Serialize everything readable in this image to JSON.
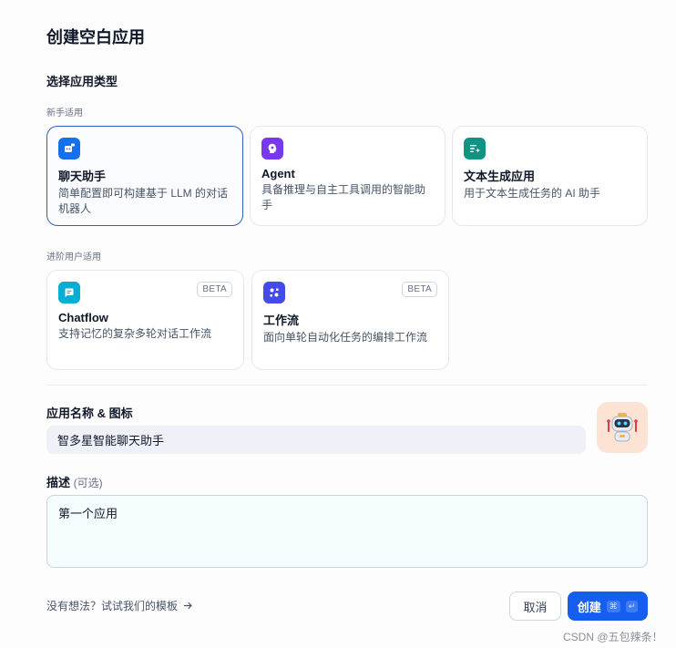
{
  "dialog": {
    "title": "创建空白应用"
  },
  "app_type": {
    "section_title": "选择应用类型",
    "beginner_label": "新手适用",
    "advanced_label": "进阶用户适用",
    "beginner_cards": [
      {
        "title": "聊天助手",
        "desc": "简单配置即可构建基于 LLM 的对话机器人",
        "icon": "chat-bot-icon",
        "color": "#1570ef",
        "selected": true
      },
      {
        "title": "Agent",
        "desc": "具备推理与自主工具调用的智能助手",
        "icon": "agent-icon",
        "color": "#7839ee",
        "selected": false
      },
      {
        "title": "文本生成应用",
        "desc": "用于文本生成任务的 AI 助手",
        "icon": "text-generation-icon",
        "color": "#0e9384",
        "selected": false
      }
    ],
    "advanced_cards": [
      {
        "title": "Chatflow",
        "desc": "支持记忆的复杂多轮对话工作流",
        "icon": "chatflow-icon",
        "color": "#06aed4",
        "badge": "BETA"
      },
      {
        "title": "工作流",
        "desc": "面向单轮自动化任务的编排工作流",
        "icon": "workflow-icon",
        "color": "#444ce7",
        "badge": "BETA"
      }
    ]
  },
  "name_field": {
    "label": "应用名称 & 图标",
    "value": "智多星智能聊天助手",
    "avatar_icon": "robot-icon",
    "avatar_bg": "#fde3d3"
  },
  "description_field": {
    "label": "描述",
    "optional": "(可选)",
    "value": "第一个应用"
  },
  "footer": {
    "template_link": "没有想法？试试我们的模板",
    "cancel_label": "取消",
    "create_label": "创建",
    "create_shortcut_cmd": "⌘",
    "create_shortcut_enter": "↵"
  },
  "watermark": "CSDN @五包辣条！"
}
